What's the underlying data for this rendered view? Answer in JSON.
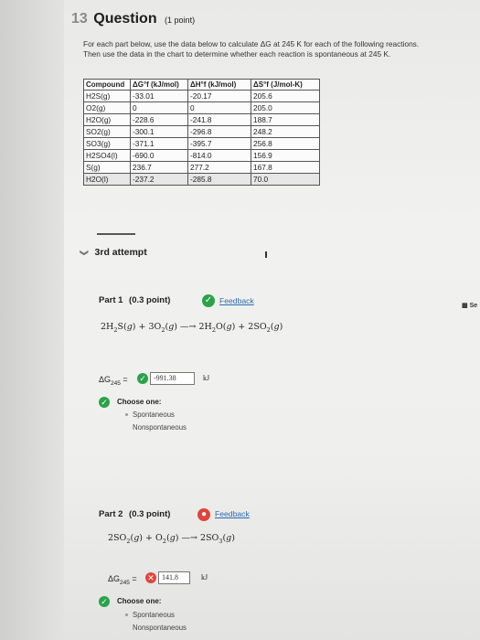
{
  "question": {
    "number": "13",
    "title": "Question",
    "points": "(1 point)",
    "instructions_line1": "For each part below, use the data below to calculate ΔG at 245 K for each of the following reactions.",
    "instructions_line2": "Then use the data in the chart to determine whether each reaction is spontaneous at 245 K."
  },
  "table": {
    "headers": [
      "Compound",
      "ΔG°f (kJ/mol)",
      "ΔH°f (kJ/mol)",
      "ΔS°f (J/mol-K)"
    ],
    "rows": [
      {
        "compound": "H2S(g)",
        "dG": "-33.01",
        "dH": "-20.17",
        "dS": "205.6"
      },
      {
        "compound": "O2(g)",
        "dG": "0",
        "dH": "0",
        "dS": "205.0"
      },
      {
        "compound": "H2O(g)",
        "dG": "-228.6",
        "dH": "-241.8",
        "dS": "188.7"
      },
      {
        "compound": "SO2(g)",
        "dG": "-300.1",
        "dH": "-296.8",
        "dS": "248.2"
      },
      {
        "compound": "SO3(g)",
        "dG": "-371.1",
        "dH": "-395.7",
        "dS": "256.8"
      },
      {
        "compound": "H2SO4(l)",
        "dG": "-690.0",
        "dH": "-814.0",
        "dS": "156.9"
      },
      {
        "compound": "S(g)",
        "dG": "236.7",
        "dH": "277.2",
        "dS": "167.8"
      },
      {
        "compound": "H2O(l)",
        "dG": "-237.2",
        "dH": "-285.8",
        "dS": "70.0"
      }
    ]
  },
  "attempt_label": "3rd attempt",
  "part1": {
    "title": "Part 1",
    "points": "(0.3 point)",
    "feedback": "Feedback",
    "dg_label": "ΔG",
    "dg_sub": "245",
    "answer_value": "-991.38",
    "unit": "kJ",
    "choose": "Choose one:",
    "options": [
      "Spontaneous",
      "Nonspontaneous"
    ]
  },
  "part2": {
    "title": "Part 2",
    "points": "(0.3 point)",
    "feedback": "Feedback",
    "dg_label": "ΔG",
    "dg_sub": "245",
    "answer_value": "141.8",
    "unit": "kJ",
    "choose": "Choose one:",
    "options": [
      "Spontaneous",
      "Nonspontaneous"
    ]
  },
  "side_text": "Se",
  "colors": {
    "check": "#2aa34a",
    "link": "#2d6ab0"
  }
}
